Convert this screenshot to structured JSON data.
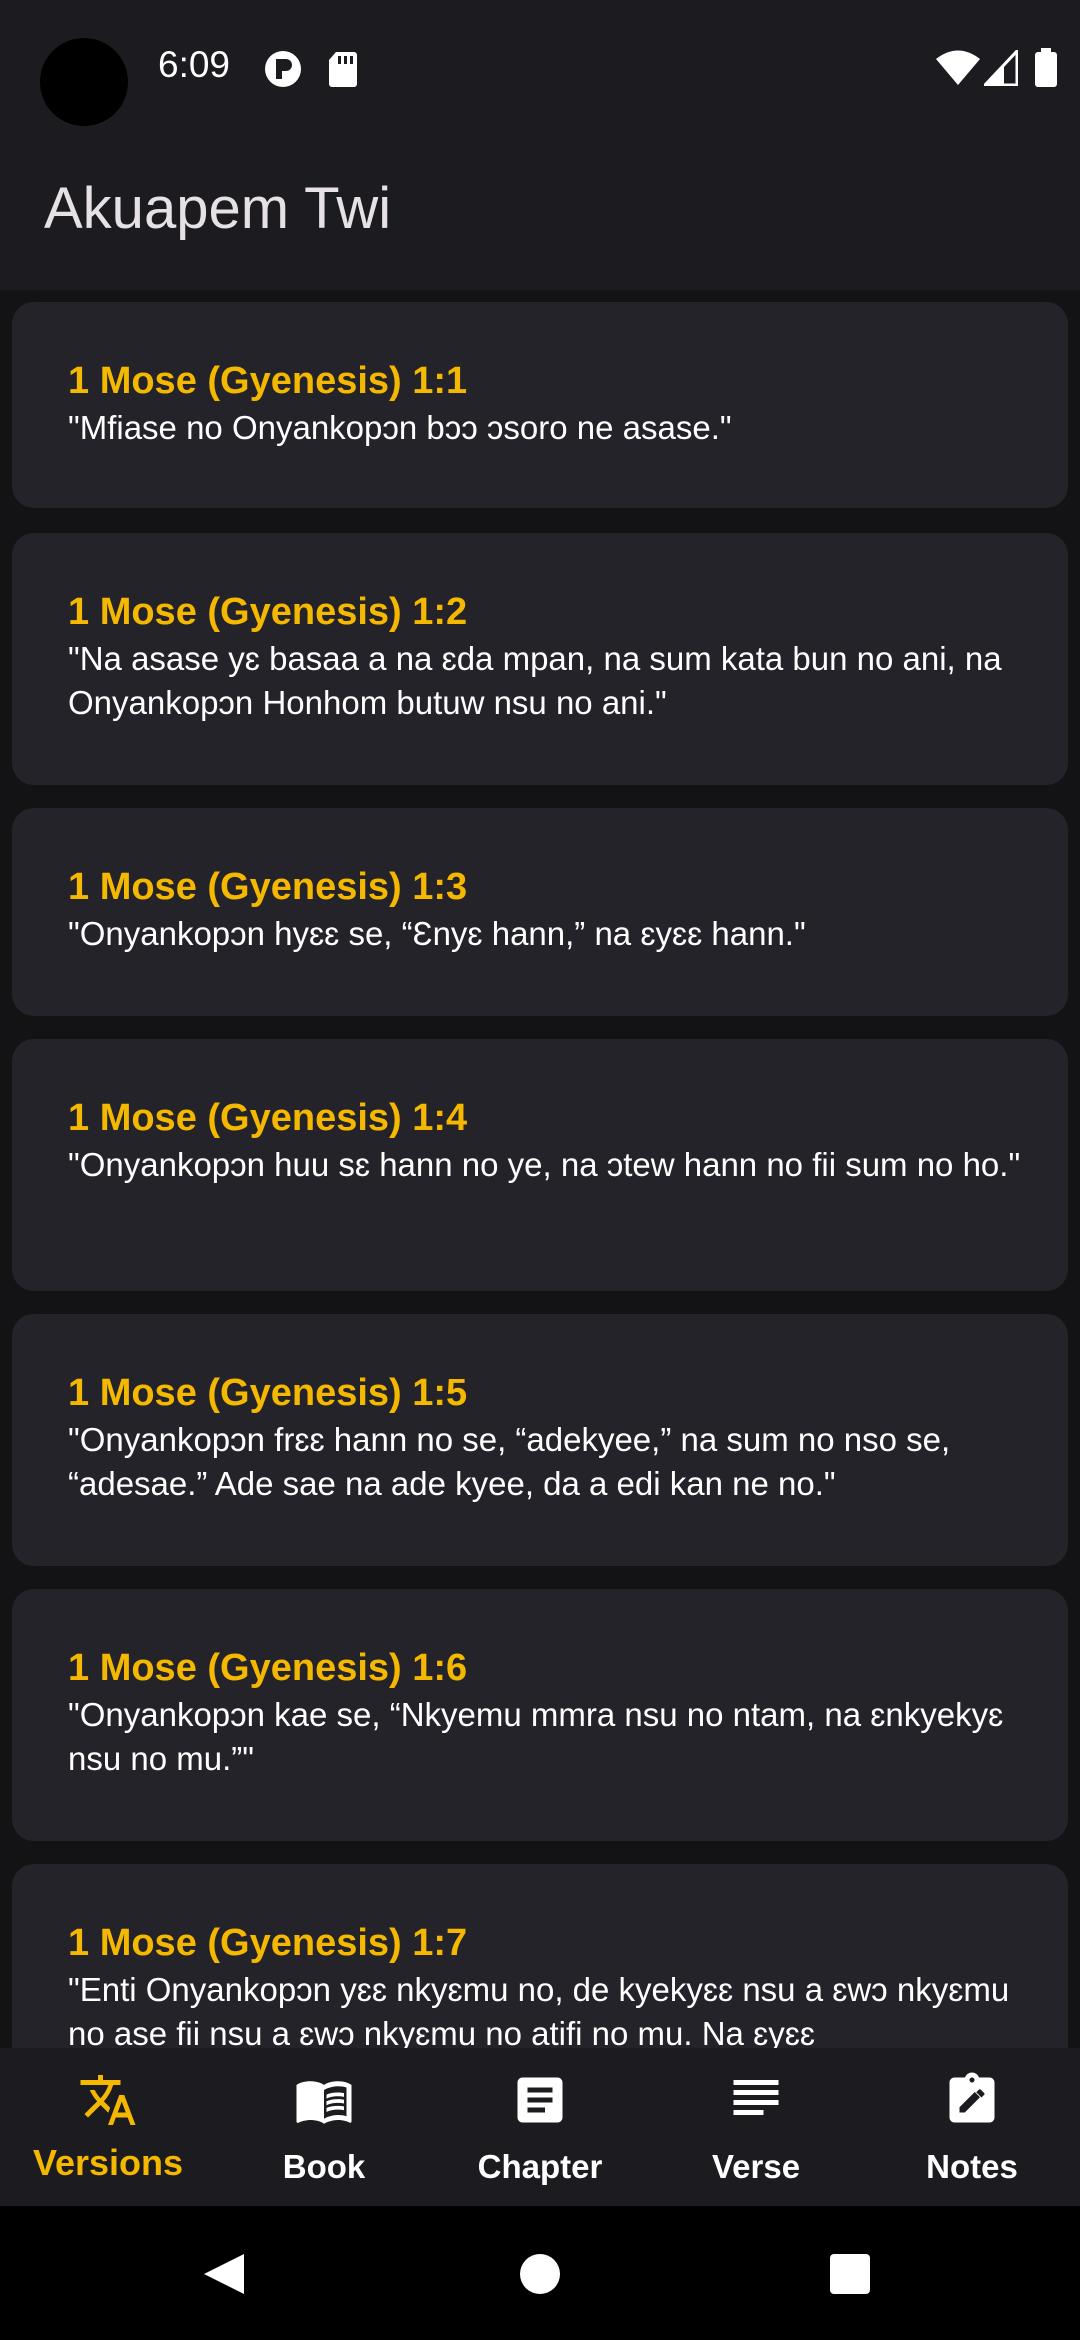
{
  "status_bar": {
    "time": "6:09"
  },
  "app_bar": {
    "title": "Akuapem Twi"
  },
  "verses": [
    {
      "ref": "1 Mose (Gyenesis) 1:1",
      "text": "\"Mfiase no Onyankopɔn bɔɔ ɔsoro ne asase.\""
    },
    {
      "ref": "1 Mose (Gyenesis) 1:2",
      "text": "\"Na asase yɛ basaa a na ɛda mpan, na sum kata bun no ani, na Onyankopɔn Honhom butuw nsu no ani.\""
    },
    {
      "ref": "1 Mose (Gyenesis) 1:3",
      "text": "\"Onyankopɔn hyɛɛ se, “Ɛnyɛ hann,” na ɛyɛɛ hann.\""
    },
    {
      "ref": "1 Mose (Gyenesis) 1:4",
      "text": "\"Onyankopɔn huu sɛ hann no ye, na ɔtew hann no fii sum no ho.\""
    },
    {
      "ref": "1 Mose (Gyenesis) 1:5",
      "text": "\"Onyankopɔn frɛɛ hann no se, “adekyee,” na sum no nso se, “adesae.” Ade sae na ade kyee, da a edi kan ne no.\""
    },
    {
      "ref": "1 Mose (Gyenesis) 1:6",
      "text": "\"Onyankopɔn kae se, “Nkyemu mmra nsu no ntam, na ɛnkyekyɛ nsu no mu.”\""
    },
    {
      "ref": "1 Mose (Gyenesis) 1:7",
      "text": "\"Enti Onyankopɔn yɛɛ nkyɛmu no, de kyekyɛɛ nsu a ɛwɔ nkyɛmu no ase fii nsu a ɛwɔ nkyɛmu no atifi no mu. Na ɛyɛɛ"
    }
  ],
  "bottom_nav": [
    {
      "label": "Versions",
      "icon": "translate-icon",
      "active": true
    },
    {
      "label": "Book",
      "icon": "book-open-icon",
      "active": false
    },
    {
      "label": "Chapter",
      "icon": "chapter-document-icon",
      "active": false
    },
    {
      "label": "Verse",
      "icon": "lines-icon",
      "active": false
    },
    {
      "label": "Notes",
      "icon": "note-edit-icon",
      "active": false
    }
  ],
  "colors": {
    "accent": "#f4b800",
    "card": "#25232a",
    "background": "#131316"
  }
}
